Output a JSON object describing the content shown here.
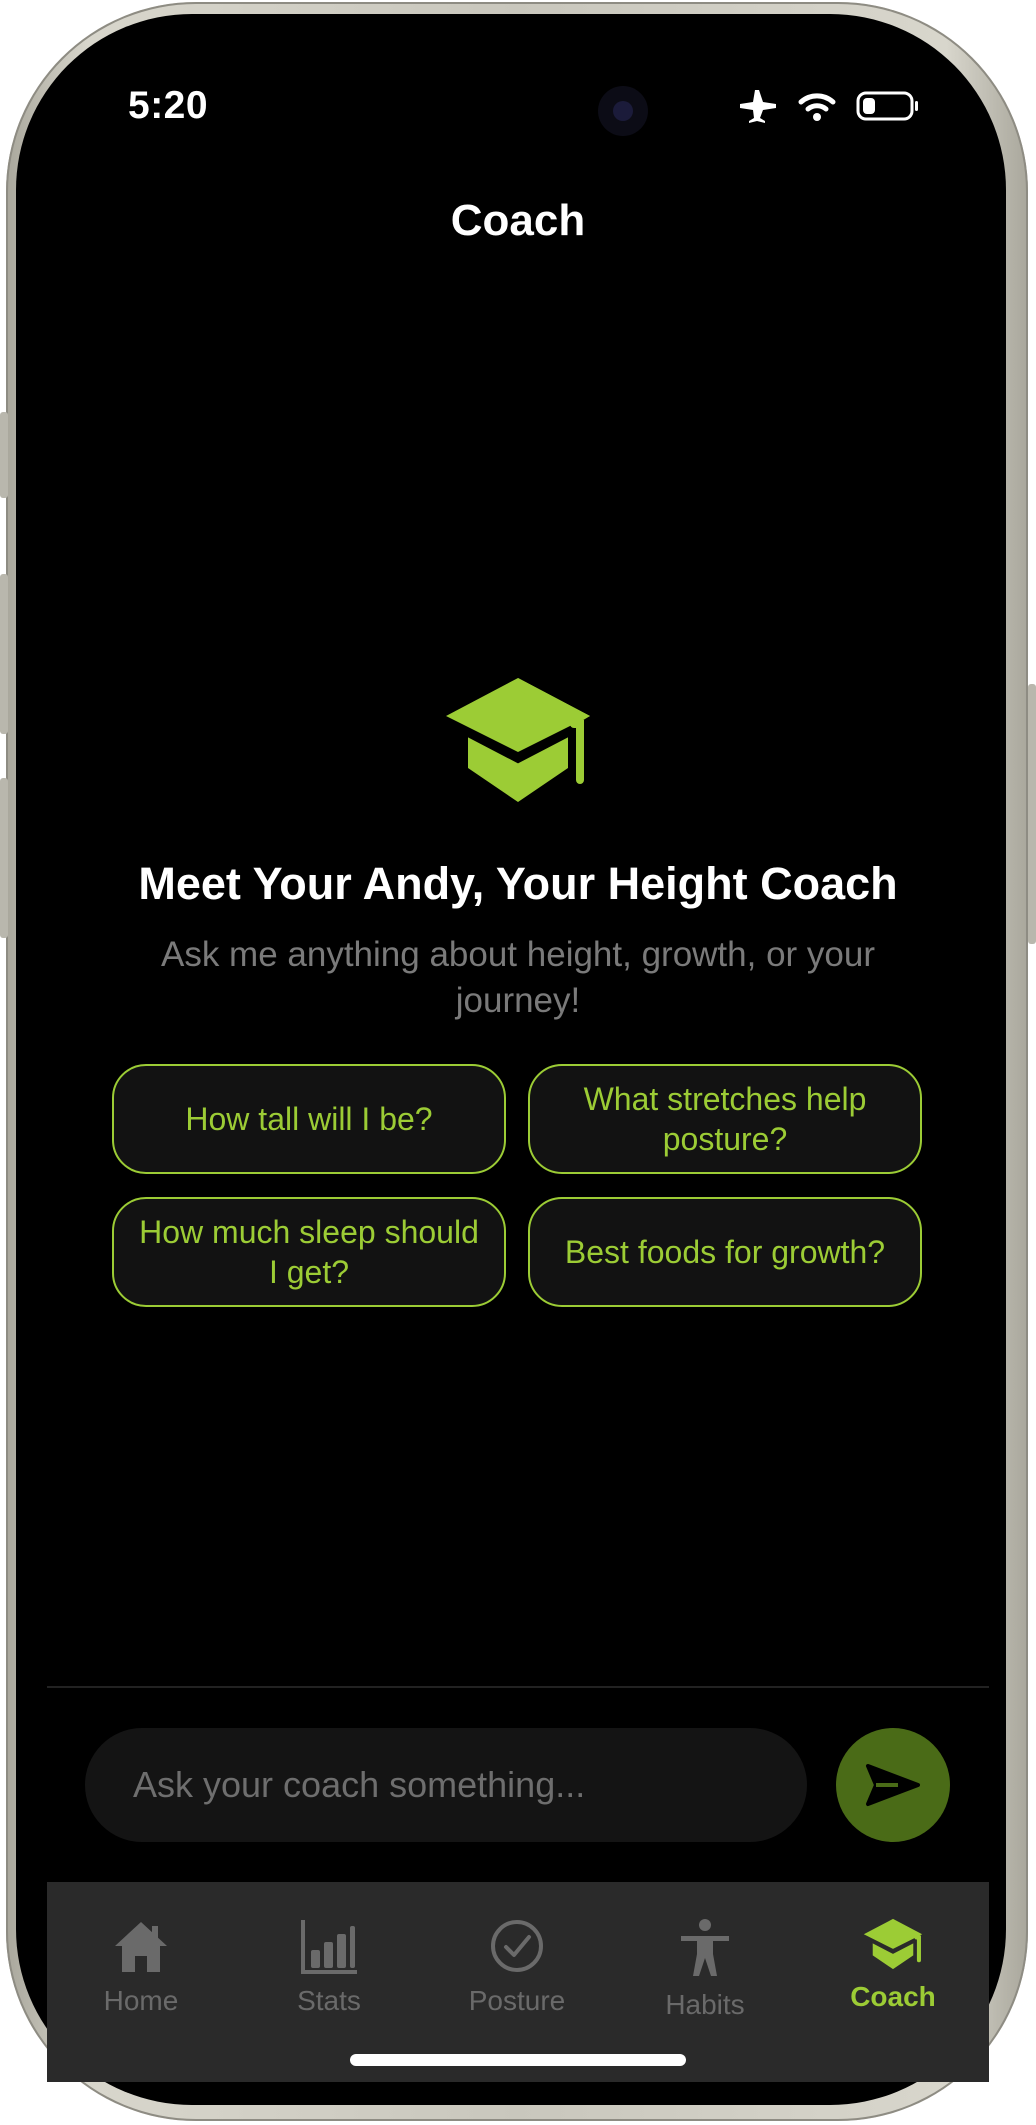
{
  "status_bar": {
    "time": "5:20"
  },
  "nav": {
    "title": "Coach"
  },
  "hero": {
    "title": "Meet Your Andy, Your Height Coach",
    "subtitle": "Ask me anything about height, growth, or your journey!"
  },
  "suggestions": [
    {
      "label": "How tall will I be?"
    },
    {
      "label": "What stretches help posture?"
    },
    {
      "label": "How much sleep should I get?"
    },
    {
      "label": "Best foods for growth?"
    }
  ],
  "composer": {
    "placeholder": "Ask your coach something..."
  },
  "tabs": [
    {
      "label": "Home",
      "icon": "home-icon"
    },
    {
      "label": "Stats",
      "icon": "stats-icon"
    },
    {
      "label": "Posture",
      "icon": "checkmark-circle-icon"
    },
    {
      "label": "Habits",
      "icon": "person-icon"
    },
    {
      "label": "Coach",
      "icon": "graduation-cap-icon",
      "active": true
    }
  ],
  "colors": {
    "accent": "#9ccc35",
    "send_button": "#4a6b17",
    "background": "#000000",
    "tabbar": "#2a2a2a"
  }
}
